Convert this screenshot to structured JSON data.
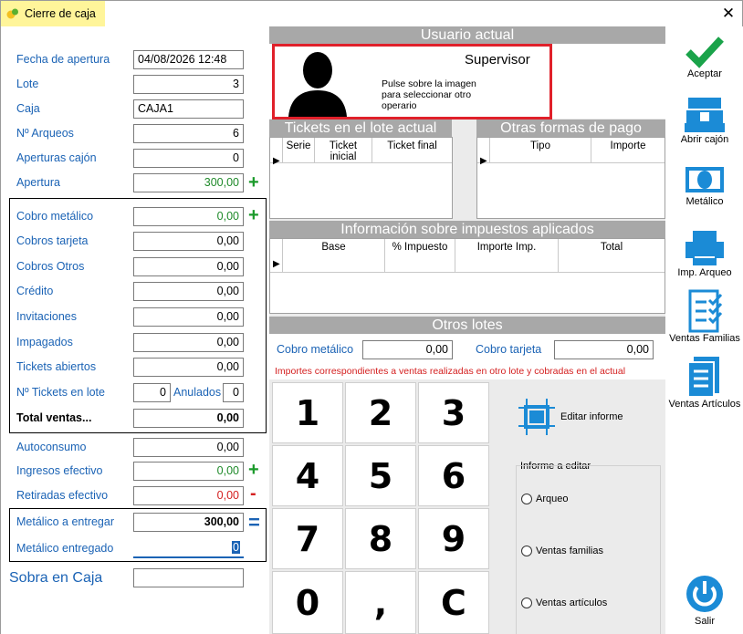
{
  "window": {
    "title": "Cierre de caja",
    "close_glyph": "✕"
  },
  "left": {
    "fecha_label": "Fecha de apertura",
    "fecha_value": "04/08/2026 12:48",
    "lote_label": "Lote",
    "lote_value": "3",
    "caja_label": "Caja",
    "caja_value": "CAJA1",
    "arqueos_label": "Nº Arqueos",
    "arqueos_value": "6",
    "aperturas_label": "Aperturas cajón",
    "aperturas_value": "0",
    "apertura_label": "Apertura",
    "apertura_value": "300,00",
    "cobro_metalico_label": "Cobro metálico",
    "cobro_metalico_value": "0,00",
    "cobros_tarjeta_label": "Cobros tarjeta",
    "cobros_tarjeta_value": "0,00",
    "cobros_otros_label": "Cobros Otros",
    "cobros_otros_value": "0,00",
    "credito_label": "Crédito",
    "credito_value": "0,00",
    "invitaciones_label": "Invitaciones",
    "invitaciones_value": "0,00",
    "impagados_label": "Impagados",
    "impagados_value": "0,00",
    "tickets_abiertos_label": "Tickets abiertos",
    "tickets_abiertos_value": "0,00",
    "tickets_lote_label": "Nº Tickets en lote",
    "tickets_lote_value": "0",
    "anulados_label": "Anulados",
    "anulados_value": "0",
    "total_ventas_label": "Total ventas...",
    "total_ventas_value": "0,00",
    "autoconsumo_label": "Autoconsumo",
    "autoconsumo_value": "0,00",
    "ingresos_label": "Ingresos efectivo",
    "ingresos_value": "0,00",
    "retiradas_label": "Retiradas efectivo",
    "retiradas_value": "0,00",
    "metalico_entregar_label": "Metálico a entregar",
    "metalico_entregar_value": "300,00",
    "metalico_entregado_label": "Metálico entregado",
    "metalico_entregado_value": "0",
    "sobra_label": "Sobra en Caja",
    "sobra_value": "",
    "plus": "+",
    "minus": "-",
    "equals": "="
  },
  "usuario": {
    "header": "Usuario actual",
    "name": "Supervisor",
    "hint": "Pulse sobre la imagen para seleccionar otro operario"
  },
  "tickets_lote": {
    "header": "Tickets en el lote actual",
    "columns": [
      "Serie",
      "Ticket inicial",
      "Ticket final"
    ]
  },
  "otras_formas": {
    "header": "Otras formas de pago",
    "columns": [
      "Tipo",
      "Importe"
    ]
  },
  "impuestos": {
    "header": "Información sobre impuestos aplicados",
    "columns": [
      "Base",
      "% Impuesto",
      "Importe Imp.",
      "Total"
    ]
  },
  "otros_lotes": {
    "header": "Otros lotes",
    "cobro_metalico_label": "Cobro metálico",
    "cobro_metalico_value": "0,00",
    "cobro_tarjeta_label": "Cobro tarjeta",
    "cobro_tarjeta_value": "0,00",
    "note": "Importes correspondientes a ventas realizadas en otro lote y cobradas en el actual"
  },
  "keypad": [
    "1",
    "2",
    "3",
    "4",
    "5",
    "6",
    "7",
    "8",
    "9",
    "0",
    ",",
    "C"
  ],
  "editar": {
    "button_label": "Editar informe",
    "group_label": "Informe a editar",
    "options": [
      "Arqueo",
      "Ventas familias",
      "Ventas artículos"
    ]
  },
  "toolbar": {
    "aceptar": "Aceptar",
    "abrir_cajon": "Abrir cajón",
    "metalico": "Metálico",
    "imp_arqueo": "Imp. Arqueo",
    "ventas_familias": "Ventas Familias",
    "ventas_articulos": "Ventas Artículos",
    "salir": "Salir"
  },
  "colors": {
    "accent": "#1b63b5",
    "green": "#1f8a2a",
    "red": "#d42020",
    "header_gray": "#a8a8a8",
    "user_border": "#e0202a"
  }
}
